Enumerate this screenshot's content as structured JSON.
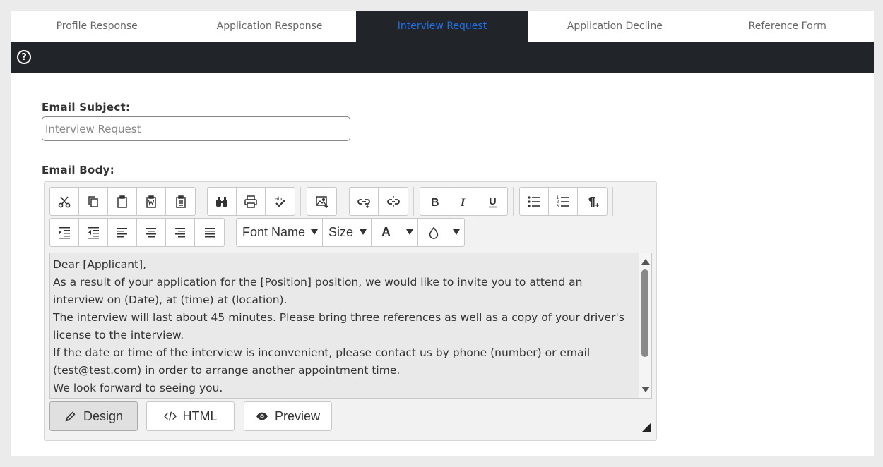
{
  "tabs": [
    {
      "label": "Profile Response"
    },
    {
      "label": "Application Response"
    },
    {
      "label": "Interview Request"
    },
    {
      "label": "Application Decline"
    },
    {
      "label": "Reference Form"
    }
  ],
  "active_tab": "Interview Request",
  "toolbar": {
    "help_icon": "?"
  },
  "email_subject": {
    "label": "Email Subject:",
    "placeholder": "Interview Request"
  },
  "email_body": {
    "label": "Email Body:",
    "dropdowns": {
      "font_name": "Font Name",
      "size": "Size",
      "font_color": "A"
    },
    "content": [
      "Dear [Applicant],",
      "As a result of your application for the [Position] position, we would like to invite you to attend an interview on (Date), at (time) at (location).",
      "The interview will last about 45 minutes. Please bring three references as well as a copy of your driver's license to the interview.",
      "If the date or time of the interview is inconvenient, please contact us by phone (number) or email (test@test.com) in order to arrange another appointment time.",
      "We look forward to seeing you."
    ],
    "modes": {
      "design": "Design",
      "html": "HTML",
      "preview": "Preview"
    }
  },
  "colors": {
    "accent": "#1f6feb",
    "dark_bar": "#212529",
    "page_bg": "#ebebeb"
  }
}
